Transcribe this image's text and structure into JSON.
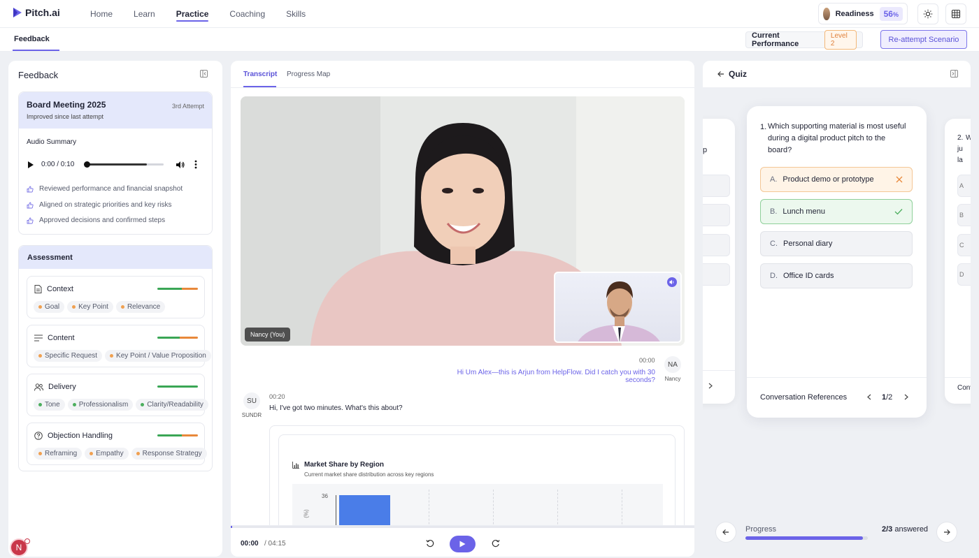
{
  "app": {
    "name": "Pitch.ai"
  },
  "nav": {
    "items": [
      "Home",
      "Learn",
      "Practice",
      "Coaching",
      "Skills"
    ],
    "active": "Practice"
  },
  "readiness": {
    "label": "Readiness",
    "value": "56",
    "unit": "%"
  },
  "subnav": {
    "tab": "Feedback"
  },
  "performance": {
    "label": "Current Performance",
    "level": "Level 2"
  },
  "reattempt_label": "Re-attempt Scenario",
  "feedback": {
    "title": "Feedback",
    "session": {
      "title": "Board Meeting 2025",
      "subtitle": "Improved since last attempt",
      "attempt": "3rd Attempt"
    },
    "audio": {
      "label": "Audio Summary",
      "time": "0:00 / 0:10"
    },
    "points": [
      "Reviewed performance and financial snapshot",
      "Aligned on strategic priorities and key risks",
      "Approved decisions and confirmed steps"
    ]
  },
  "assessment": {
    "title": "Assessment",
    "items": [
      {
        "name": "Context",
        "icon": "document-icon",
        "chips": [
          "Goal",
          "Key Point",
          "Relevance"
        ]
      },
      {
        "name": "Content",
        "icon": "lines-icon",
        "chips": [
          "Specific Request",
          "Key Point / Value Proposition"
        ]
      },
      {
        "name": "Delivery",
        "icon": "users-icon",
        "chips": [
          "Tone",
          "Professionalism",
          "Clarity/Readability"
        ]
      },
      {
        "name": "Objection Handling",
        "icon": "question-icon",
        "chips": [
          "Reframing",
          "Empathy",
          "Response Strategy"
        ]
      }
    ]
  },
  "transcript": {
    "tabs": [
      "Transcript",
      "Progress Map"
    ],
    "active_tab": "Transcript",
    "video_label": "Nancy (You)",
    "messages": [
      {
        "initials": "NA",
        "name": "Nancy",
        "time": "00:00",
        "text": "Hi Um Alex—this is Arjun from HelpFlow. Did I catch you with 30 seconds?"
      },
      {
        "initials": "SU",
        "name": "SUNDR",
        "time": "00:20",
        "text": "Hi, I've got two minutes. What's this about?"
      }
    ],
    "embed_chart": {
      "title": "Market Share by Region",
      "subtitle": "Current market share distribution across key regions",
      "ytick": "36",
      "ylabel": "(%)"
    },
    "playback": {
      "current": "00:00",
      "total": "/ 04:15"
    }
  },
  "quiz": {
    "title": "Quiz",
    "question_number": "1.",
    "question": "Which supporting material is most useful during a digital product pitch to the board?",
    "options": [
      {
        "key": "A.",
        "text": "Product demo or prototype",
        "state": "wrong"
      },
      {
        "key": "B.",
        "text": "Lunch menu",
        "state": "correct"
      },
      {
        "key": "C.",
        "text": "Personal diary",
        "state": "none"
      },
      {
        "key": "D.",
        "text": "Office ID cards",
        "state": "none"
      }
    ],
    "references_label": "Conversation References",
    "page_current": "1",
    "page_total": "/2",
    "next_card": {
      "number": "2.",
      "lines": [
        "W",
        "ju",
        "la"
      ],
      "options": [
        "A",
        "B",
        "C",
        "D"
      ],
      "footer": "Conv"
    },
    "prev_card": {
      "line": "p"
    },
    "progress": {
      "label": "Progress",
      "answered": "2/3",
      "answered_suffix": " answered",
      "fraction": 0.96
    }
  },
  "user_avatar": {
    "initial": "N"
  },
  "colors": {
    "accent": "#6b63e8",
    "correct": "#5ab66a",
    "wrong": "#e8883a",
    "score_green": "#3aa655",
    "score_orange": "#e8883a"
  }
}
